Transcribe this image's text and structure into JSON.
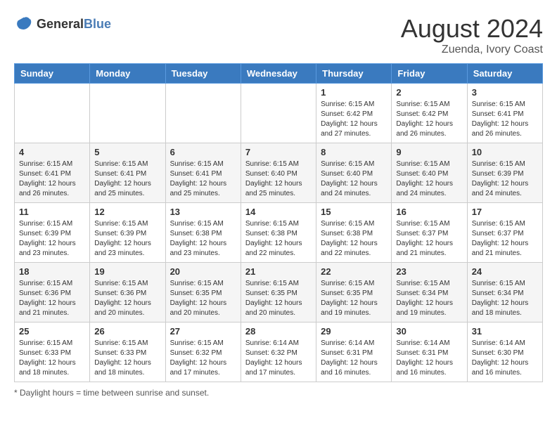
{
  "header": {
    "logo_general": "General",
    "logo_blue": "Blue",
    "month_year": "August 2024",
    "location": "Zuenda, Ivory Coast"
  },
  "days_of_week": [
    "Sunday",
    "Monday",
    "Tuesday",
    "Wednesday",
    "Thursday",
    "Friday",
    "Saturday"
  ],
  "footer": {
    "note": "Daylight hours"
  },
  "weeks": [
    [
      {
        "day": "",
        "sunrise": "",
        "sunset": "",
        "daylight": ""
      },
      {
        "day": "",
        "sunrise": "",
        "sunset": "",
        "daylight": ""
      },
      {
        "day": "",
        "sunrise": "",
        "sunset": "",
        "daylight": ""
      },
      {
        "day": "",
        "sunrise": "",
        "sunset": "",
        "daylight": ""
      },
      {
        "day": "1",
        "sunrise": "Sunrise: 6:15 AM",
        "sunset": "Sunset: 6:42 PM",
        "daylight": "Daylight: 12 hours and 27 minutes."
      },
      {
        "day": "2",
        "sunrise": "Sunrise: 6:15 AM",
        "sunset": "Sunset: 6:42 PM",
        "daylight": "Daylight: 12 hours and 26 minutes."
      },
      {
        "day": "3",
        "sunrise": "Sunrise: 6:15 AM",
        "sunset": "Sunset: 6:41 PM",
        "daylight": "Daylight: 12 hours and 26 minutes."
      }
    ],
    [
      {
        "day": "4",
        "sunrise": "Sunrise: 6:15 AM",
        "sunset": "Sunset: 6:41 PM",
        "daylight": "Daylight: 12 hours and 26 minutes."
      },
      {
        "day": "5",
        "sunrise": "Sunrise: 6:15 AM",
        "sunset": "Sunset: 6:41 PM",
        "daylight": "Daylight: 12 hours and 25 minutes."
      },
      {
        "day": "6",
        "sunrise": "Sunrise: 6:15 AM",
        "sunset": "Sunset: 6:41 PM",
        "daylight": "Daylight: 12 hours and 25 minutes."
      },
      {
        "day": "7",
        "sunrise": "Sunrise: 6:15 AM",
        "sunset": "Sunset: 6:40 PM",
        "daylight": "Daylight: 12 hours and 25 minutes."
      },
      {
        "day": "8",
        "sunrise": "Sunrise: 6:15 AM",
        "sunset": "Sunset: 6:40 PM",
        "daylight": "Daylight: 12 hours and 24 minutes."
      },
      {
        "day": "9",
        "sunrise": "Sunrise: 6:15 AM",
        "sunset": "Sunset: 6:40 PM",
        "daylight": "Daylight: 12 hours and 24 minutes."
      },
      {
        "day": "10",
        "sunrise": "Sunrise: 6:15 AM",
        "sunset": "Sunset: 6:39 PM",
        "daylight": "Daylight: 12 hours and 24 minutes."
      }
    ],
    [
      {
        "day": "11",
        "sunrise": "Sunrise: 6:15 AM",
        "sunset": "Sunset: 6:39 PM",
        "daylight": "Daylight: 12 hours and 23 minutes."
      },
      {
        "day": "12",
        "sunrise": "Sunrise: 6:15 AM",
        "sunset": "Sunset: 6:39 PM",
        "daylight": "Daylight: 12 hours and 23 minutes."
      },
      {
        "day": "13",
        "sunrise": "Sunrise: 6:15 AM",
        "sunset": "Sunset: 6:38 PM",
        "daylight": "Daylight: 12 hours and 23 minutes."
      },
      {
        "day": "14",
        "sunrise": "Sunrise: 6:15 AM",
        "sunset": "Sunset: 6:38 PM",
        "daylight": "Daylight: 12 hours and 22 minutes."
      },
      {
        "day": "15",
        "sunrise": "Sunrise: 6:15 AM",
        "sunset": "Sunset: 6:38 PM",
        "daylight": "Daylight: 12 hours and 22 minutes."
      },
      {
        "day": "16",
        "sunrise": "Sunrise: 6:15 AM",
        "sunset": "Sunset: 6:37 PM",
        "daylight": "Daylight: 12 hours and 21 minutes."
      },
      {
        "day": "17",
        "sunrise": "Sunrise: 6:15 AM",
        "sunset": "Sunset: 6:37 PM",
        "daylight": "Daylight: 12 hours and 21 minutes."
      }
    ],
    [
      {
        "day": "18",
        "sunrise": "Sunrise: 6:15 AM",
        "sunset": "Sunset: 6:36 PM",
        "daylight": "Daylight: 12 hours and 21 minutes."
      },
      {
        "day": "19",
        "sunrise": "Sunrise: 6:15 AM",
        "sunset": "Sunset: 6:36 PM",
        "daylight": "Daylight: 12 hours and 20 minutes."
      },
      {
        "day": "20",
        "sunrise": "Sunrise: 6:15 AM",
        "sunset": "Sunset: 6:35 PM",
        "daylight": "Daylight: 12 hours and 20 minutes."
      },
      {
        "day": "21",
        "sunrise": "Sunrise: 6:15 AM",
        "sunset": "Sunset: 6:35 PM",
        "daylight": "Daylight: 12 hours and 20 minutes."
      },
      {
        "day": "22",
        "sunrise": "Sunrise: 6:15 AM",
        "sunset": "Sunset: 6:35 PM",
        "daylight": "Daylight: 12 hours and 19 minutes."
      },
      {
        "day": "23",
        "sunrise": "Sunrise: 6:15 AM",
        "sunset": "Sunset: 6:34 PM",
        "daylight": "Daylight: 12 hours and 19 minutes."
      },
      {
        "day": "24",
        "sunrise": "Sunrise: 6:15 AM",
        "sunset": "Sunset: 6:34 PM",
        "daylight": "Daylight: 12 hours and 18 minutes."
      }
    ],
    [
      {
        "day": "25",
        "sunrise": "Sunrise: 6:15 AM",
        "sunset": "Sunset: 6:33 PM",
        "daylight": "Daylight: 12 hours and 18 minutes."
      },
      {
        "day": "26",
        "sunrise": "Sunrise: 6:15 AM",
        "sunset": "Sunset: 6:33 PM",
        "daylight": "Daylight: 12 hours and 18 minutes."
      },
      {
        "day": "27",
        "sunrise": "Sunrise: 6:15 AM",
        "sunset": "Sunset: 6:32 PM",
        "daylight": "Daylight: 12 hours and 17 minutes."
      },
      {
        "day": "28",
        "sunrise": "Sunrise: 6:14 AM",
        "sunset": "Sunset: 6:32 PM",
        "daylight": "Daylight: 12 hours and 17 minutes."
      },
      {
        "day": "29",
        "sunrise": "Sunrise: 6:14 AM",
        "sunset": "Sunset: 6:31 PM",
        "daylight": "Daylight: 12 hours and 16 minutes."
      },
      {
        "day": "30",
        "sunrise": "Sunrise: 6:14 AM",
        "sunset": "Sunset: 6:31 PM",
        "daylight": "Daylight: 12 hours and 16 minutes."
      },
      {
        "day": "31",
        "sunrise": "Sunrise: 6:14 AM",
        "sunset": "Sunset: 6:30 PM",
        "daylight": "Daylight: 12 hours and 16 minutes."
      }
    ]
  ]
}
